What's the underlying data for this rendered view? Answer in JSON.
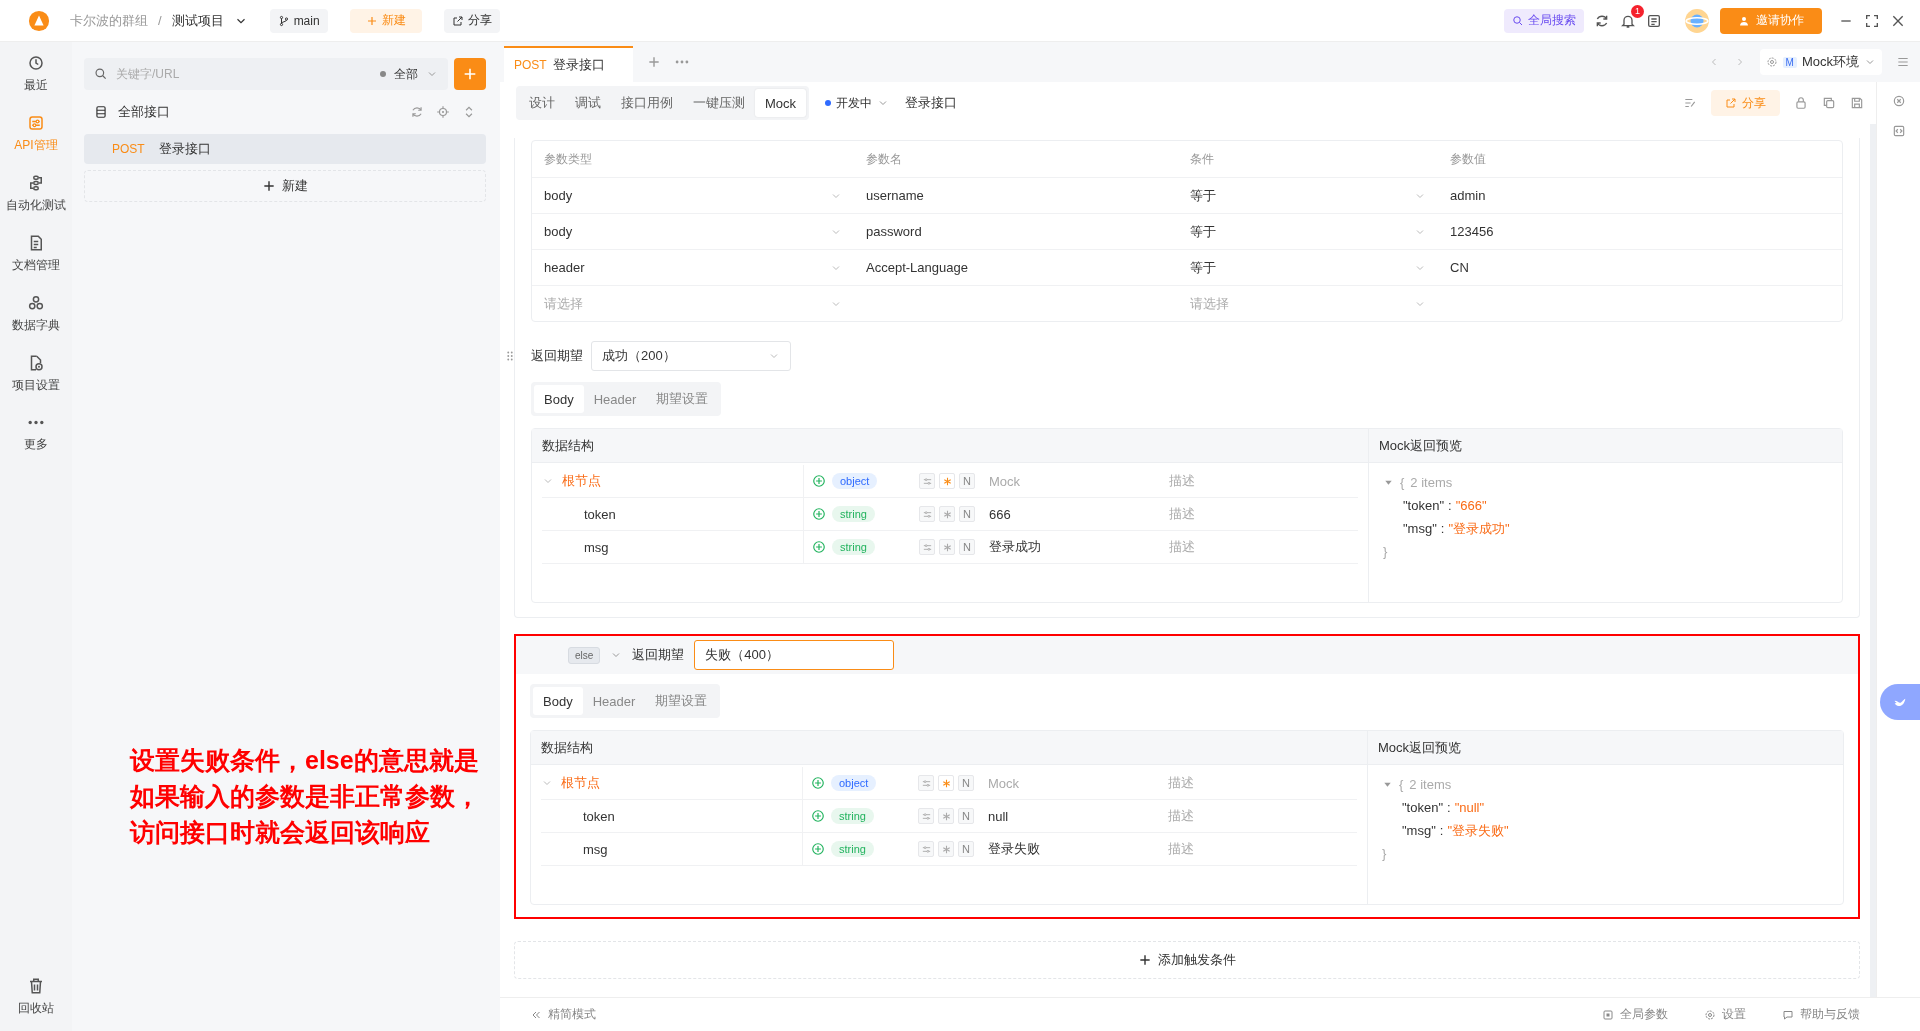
{
  "header": {
    "team": "卡尔波的群组",
    "separator": "/",
    "project": "测试项目",
    "branch": "main",
    "new_button": "新建",
    "share_button": "分享",
    "search_button": "全局搜索",
    "notification_count": "1",
    "invite_button": "邀请协作"
  },
  "nav": [
    {
      "label": "最近",
      "selected": false
    },
    {
      "label": "API管理",
      "selected": true
    },
    {
      "label": "自动化测试",
      "selected": false
    },
    {
      "label": "文档管理",
      "selected": false
    },
    {
      "label": "数据字典",
      "selected": false
    },
    {
      "label": "项目设置",
      "selected": false
    },
    {
      "label": "更多",
      "selected": false
    }
  ],
  "trash": "回收站",
  "sidebar": {
    "search": {
      "placeholder": "关键字/URL"
    },
    "filter": "全部",
    "root": "全部接口",
    "items": [
      {
        "method": "POST",
        "name": "登录接口",
        "selected": true
      }
    ],
    "new_button": "新建"
  },
  "tab": {
    "method": "POST",
    "title": "登录接口"
  },
  "environment": {
    "badge": "M",
    "name": "Mock环境"
  },
  "subtabs": [
    {
      "label": "设计",
      "selected": false
    },
    {
      "label": "调试",
      "selected": false
    },
    {
      "label": "接口用例",
      "selected": false
    },
    {
      "label": "一键压测",
      "selected": false
    },
    {
      "label": "Mock",
      "selected": true
    }
  ],
  "status": "开发中",
  "api_name": "登录接口",
  "share": "分享",
  "conditions": {
    "columns": [
      "参数类型",
      "参数名",
      "条件",
      "参数值"
    ],
    "rows": [
      {
        "placeholder": false,
        "param_type": "body",
        "name": "username",
        "condition": "等于",
        "value": "admin"
      },
      {
        "placeholder": false,
        "param_type": "body",
        "name": "password",
        "condition": "等于",
        "value": "123456"
      },
      {
        "placeholder": false,
        "param_type": "header",
        "name": "Accept-Language",
        "condition": "等于",
        "value": "CN"
      },
      {
        "placeholder": true,
        "param_type": "请选择",
        "condition": "请选择"
      }
    ]
  },
  "expectations": [
    {
      "kind": "if",
      "highlighted": false,
      "label": "返回期望",
      "value": "成功（200）",
      "tabs": [
        {
          "label": "Body",
          "selected": true
        },
        {
          "label": "Header",
          "selected": false
        },
        {
          "label": "期望设置",
          "selected": false
        }
      ],
      "columns": [
        "数据结构",
        "Mock返回预览"
      ],
      "fields": [
        {
          "name": "根节点",
          "expanded": true,
          "type": "object",
          "required": true,
          "null_mark": "N",
          "mock": "Mock",
          "mock_placeholder": true,
          "description": "描述"
        },
        {
          "name": "token",
          "type": "string",
          "required": false,
          "null_mark": "N",
          "mock": "666",
          "mock_placeholder": false,
          "description": "描述"
        },
        {
          "name": "msg",
          "type": "string",
          "required": false,
          "null_mark": "N",
          "mock": "登录成功",
          "mock_placeholder": false,
          "description": "描述"
        }
      ],
      "preview": {
        "open": "{",
        "count": "2 items",
        "entries": [
          {
            "key": "\"token\"",
            "sep": ":",
            "value": "\"666\""
          },
          {
            "key": "\"msg\"",
            "sep": ":",
            "value": "\"登录成功\""
          }
        ],
        "close": "}"
      }
    },
    {
      "kind": "else",
      "highlighted": true,
      "badge": "else",
      "label": "返回期望",
      "value": "失败（400）",
      "tabs": [
        {
          "label": "Body",
          "selected": true
        },
        {
          "label": "Header",
          "selected": false
        },
        {
          "label": "期望设置",
          "selected": false
        }
      ],
      "columns": [
        "数据结构",
        "Mock返回预览"
      ],
      "fields": [
        {
          "name": "根节点",
          "expanded": true,
          "type": "object",
          "required": true,
          "null_mark": "N",
          "mock": "Mock",
          "mock_placeholder": true,
          "description": "描述"
        },
        {
          "name": "token",
          "type": "string",
          "required": false,
          "null_mark": "N",
          "mock": "null",
          "mock_placeholder": false,
          "description": "描述"
        },
        {
          "name": "msg",
          "type": "string",
          "required": false,
          "null_mark": "N",
          "mock": "登录失败",
          "mock_placeholder": false,
          "description": "描述"
        }
      ],
      "preview": {
        "open": "{",
        "count": "2 items",
        "entries": [
          {
            "key": "\"token\"",
            "sep": ":",
            "value": "\"null\""
          },
          {
            "key": "\"msg\"",
            "sep": ":",
            "value": "\"登录失败\""
          }
        ],
        "close": "}"
      }
    }
  ],
  "add_condition": "添加触发条件",
  "annotation": [
    "设置失败条件，else的意思就是",
    "如果输入的参数是非正常参数，",
    "访问接口时就会返回该响应"
  ],
  "footer": {
    "mode": "精简模式",
    "links": [
      "全局参数",
      "设置",
      "帮助与反馈"
    ]
  }
}
